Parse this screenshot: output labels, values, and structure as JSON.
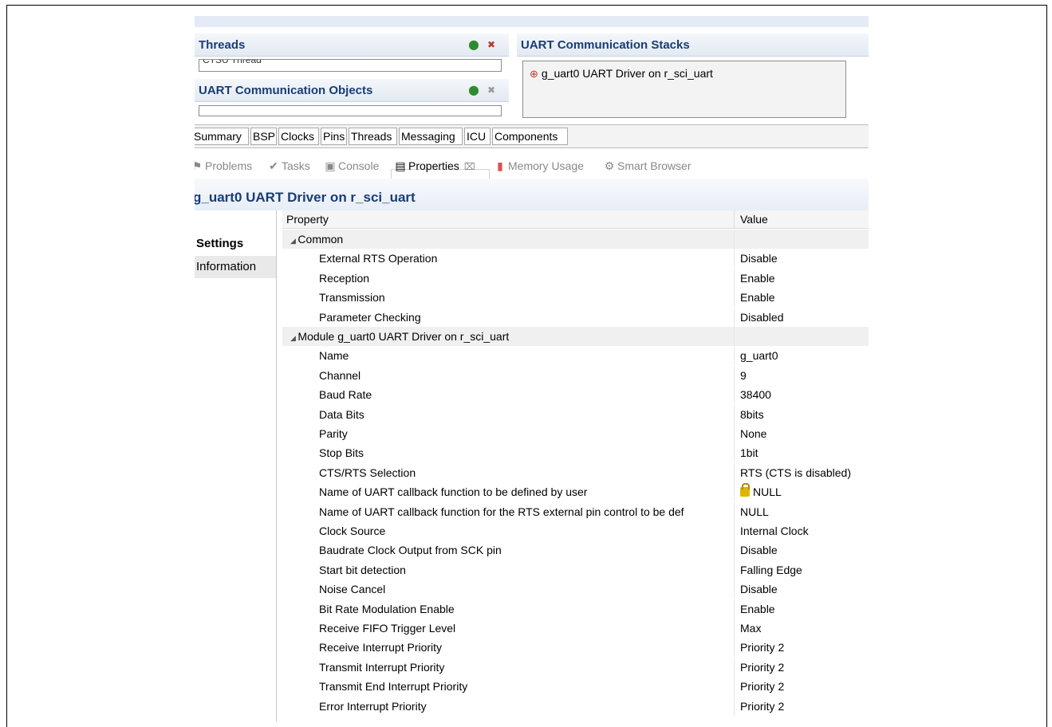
{
  "threads_panel": {
    "title": "Threads",
    "first_item": "CTSU Thread"
  },
  "objects_panel": {
    "title": "UART Communication Objects"
  },
  "stacks_panel": {
    "title": "UART Communication Stacks",
    "item": "g_uart0 UART Driver on r_sci_uart"
  },
  "config_tabs": [
    "Summary",
    "BSP",
    "Clocks",
    "Pins",
    "Threads",
    "Messaging",
    "ICU",
    "Components"
  ],
  "view_tabs": [
    {
      "label": "Problems",
      "icon": "problems-icon"
    },
    {
      "label": "Tasks",
      "icon": "tasks-icon"
    },
    {
      "label": "Console",
      "icon": "console-icon"
    },
    {
      "label": "Properties",
      "icon": "properties-icon",
      "close": "⌧"
    },
    {
      "label": "Memory Usage",
      "icon": "memory-icon"
    },
    {
      "label": "Smart Browser",
      "icon": "smart-browser-icon"
    }
  ],
  "properties_title": "g_uart0 UART Driver on r_sci_uart",
  "side_tabs": [
    "Settings",
    "Information"
  ],
  "table": {
    "col_property": "Property",
    "col_value": "Value",
    "rows": [
      {
        "group": true,
        "prop": "Common",
        "value": ""
      },
      {
        "prop": "External RTS Operation",
        "value": "Disable"
      },
      {
        "prop": "Reception",
        "value": "Enable"
      },
      {
        "prop": "Transmission",
        "value": "Enable"
      },
      {
        "prop": "Parameter Checking",
        "value": "Disabled"
      },
      {
        "group": true,
        "prop": "Module g_uart0 UART Driver on r_sci_uart",
        "value": ""
      },
      {
        "prop": "Name",
        "value": "g_uart0"
      },
      {
        "prop": "Channel",
        "value": "9"
      },
      {
        "prop": "Baud Rate",
        "value": "38400"
      },
      {
        "prop": "Data Bits",
        "value": "8bits"
      },
      {
        "prop": "Parity",
        "value": "None"
      },
      {
        "prop": "Stop Bits",
        "value": "1bit"
      },
      {
        "prop": "CTS/RTS Selection",
        "value": "RTS (CTS is disabled)"
      },
      {
        "prop": "Name of UART callback function to be defined by user",
        "value": "NULL",
        "locked": true
      },
      {
        "prop": "Name of UART callback function for the RTS external pin control to be def",
        "value": "NULL"
      },
      {
        "prop": "Clock Source",
        "value": "Internal Clock"
      },
      {
        "prop": "Baudrate Clock Output from SCK pin",
        "value": "Disable"
      },
      {
        "prop": "Start bit detection",
        "value": "Falling Edge"
      },
      {
        "prop": "Noise Cancel",
        "value": "Disable"
      },
      {
        "prop": "Bit Rate Modulation Enable",
        "value": "Enable"
      },
      {
        "prop": "Receive FIFO Trigger Level",
        "value": "Max"
      },
      {
        "prop": "Receive Interrupt Priority",
        "value": "Priority 2"
      },
      {
        "prop": "Transmit Interrupt Priority",
        "value": "Priority 2"
      },
      {
        "prop": "Transmit End Interrupt Priority",
        "value": "Priority 2"
      },
      {
        "prop": "Error Interrupt Priority",
        "value": "Priority 2"
      }
    ]
  },
  "colors": {
    "header_text": "#183d75",
    "group_bg": "#f0f0f0"
  }
}
